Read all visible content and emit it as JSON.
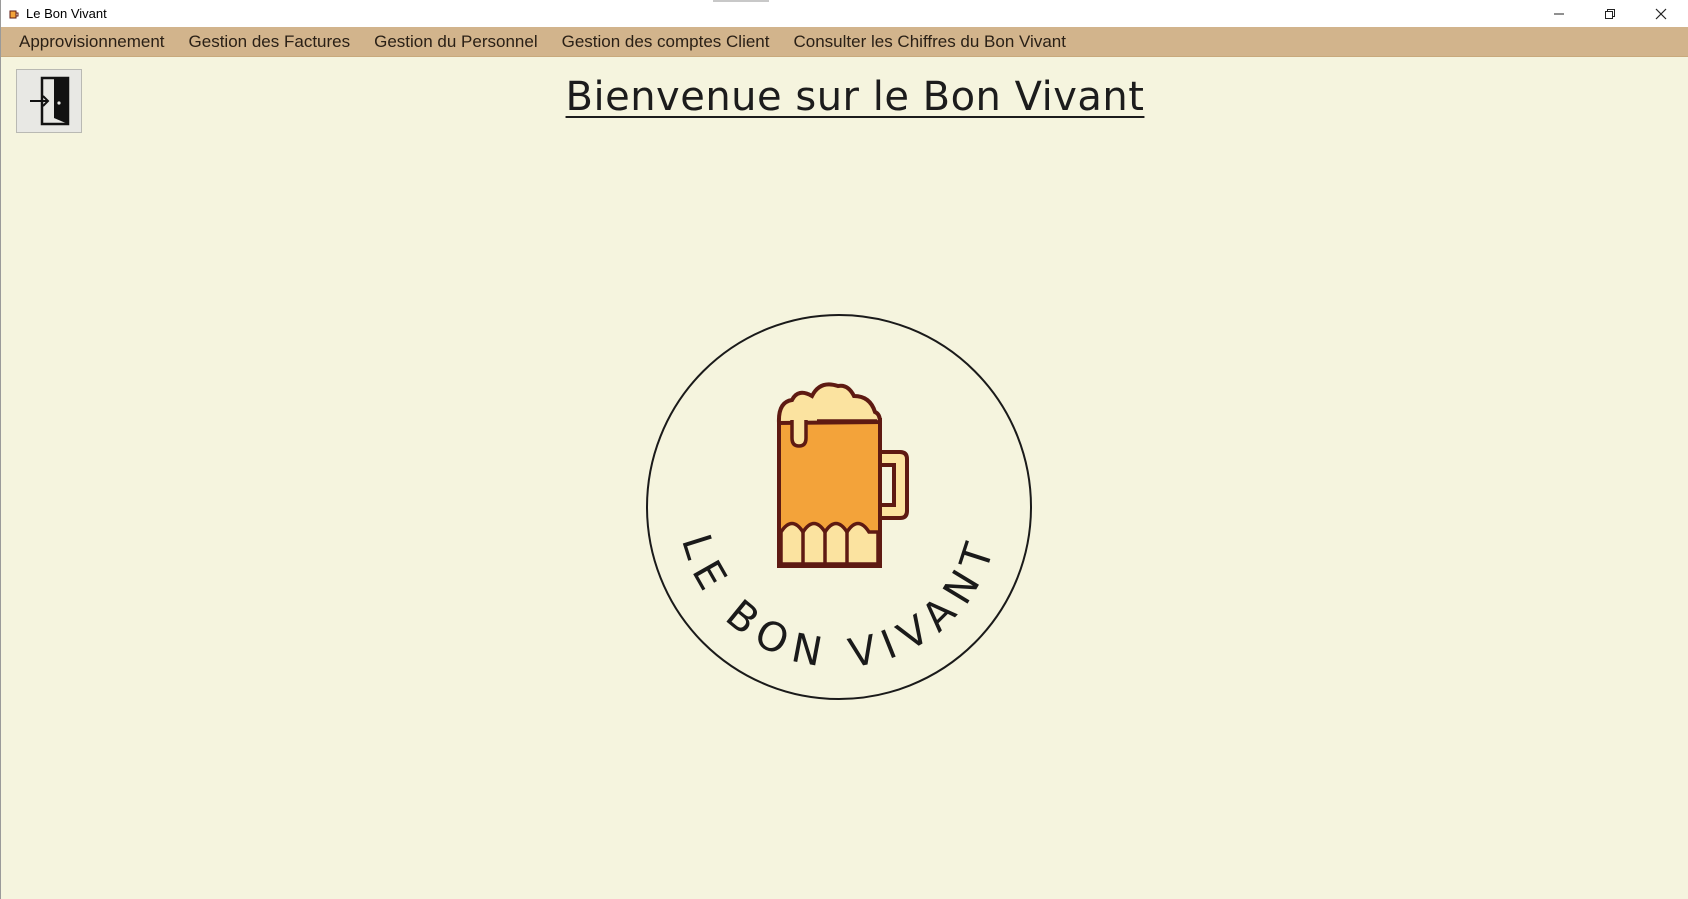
{
  "window": {
    "title": "Le Bon Vivant",
    "controls": [
      "minimize",
      "maximize",
      "close"
    ]
  },
  "menubar": {
    "items": [
      {
        "label": "Approvisionnement"
      },
      {
        "label": "Gestion des Factures"
      },
      {
        "label": "Gestion du Personnel"
      },
      {
        "label": "Gestion des comptes Client"
      },
      {
        "label": "Consulter les Chiffres du Bon Vivant"
      }
    ]
  },
  "toolbar": {
    "exit_icon": "exit-door-icon"
  },
  "main": {
    "heading": "Bienvenue sur le Bon Vivant",
    "logo": {
      "text": "LE BON VIVANT",
      "icon": "beer-mug-icon"
    }
  },
  "colors": {
    "background": "#f5f4de",
    "menubar": "#d2b48c",
    "beer": "#f3a33a",
    "foam": "#fbe3a0",
    "outline": "#5e1a12"
  }
}
